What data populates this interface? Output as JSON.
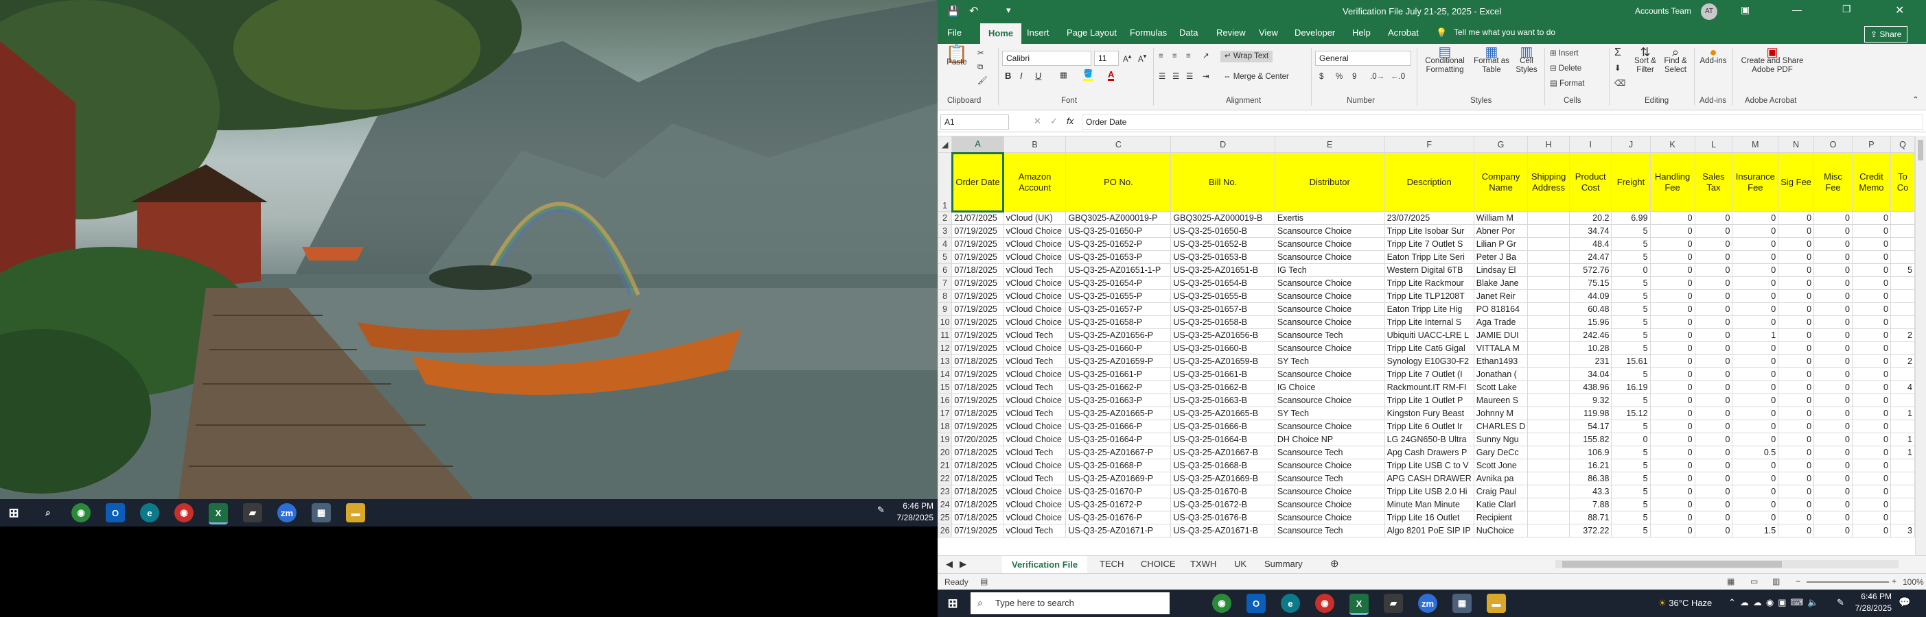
{
  "left_taskbar": {
    "time": "6:46 PM",
    "date": "7/28/2025"
  },
  "excel": {
    "quick_access": {
      "autosave_glyph": "💾",
      "undo_glyph": "↶"
    },
    "title": "Verification File July 21-25, 2025  -  Excel",
    "account": "Accounts Team",
    "account_initials": "AT",
    "tabs": [
      "File",
      "Home",
      "Insert",
      "Page Layout",
      "Formulas",
      "Data",
      "Review",
      "View",
      "Developer",
      "Help",
      "Acrobat"
    ],
    "tell_me": "Tell me what you want to do",
    "share": "Share",
    "ribbon": {
      "clipboard": {
        "label": "Clipboard",
        "paste": "Paste"
      },
      "font": {
        "label": "Font",
        "name": "Calibri",
        "size": "11",
        "bold": "B",
        "italic": "I",
        "underline": "U"
      },
      "alignment": {
        "label": "Alignment",
        "wrap": "Wrap Text",
        "merge": "Merge & Center"
      },
      "number": {
        "label": "Number",
        "format": "General",
        "currency": "$",
        "percent": "%",
        "comma": "9"
      },
      "styles": {
        "label": "Styles",
        "conditional": "Conditional Formatting",
        "format_table": "Format as Table",
        "cell_styles": "Cell Styles"
      },
      "cells": {
        "label": "Cells",
        "insert": "Insert",
        "delete": "Delete",
        "format": "Format"
      },
      "editing": {
        "label": "Editing",
        "sort": "Sort & Filter",
        "find": "Find & Select"
      },
      "addins": {
        "label": "Add-ins",
        "btn": "Add-ins"
      },
      "acrobat": {
        "label": "Adobe Acrobat",
        "btn": "Create and Share Adobe PDF"
      }
    },
    "name_box": "A1",
    "formula_glyphs": {
      "cancel": "✕",
      "enter": "✓",
      "fx": "fx"
    },
    "formula_value": "Order Date",
    "columns": [
      "A",
      "B",
      "C",
      "D",
      "E",
      "F",
      "G",
      "H",
      "I",
      "J",
      "K",
      "L",
      "M",
      "N",
      "O",
      "P",
      "Q"
    ],
    "header_row": [
      "Order Date",
      "Amazon Account",
      "PO No.",
      "Bill No.",
      "Distributor",
      "Description",
      "Company Name",
      "Shipping Address",
      "Product Cost",
      "Freight",
      "Handling Fee",
      "Sales Tax",
      "Insurance Fee",
      "Sig Fee",
      "Misc Fee",
      "Credit Memo",
      "To Co"
    ],
    "rows": [
      {
        "n": "2",
        "c": [
          "21/07/2025",
          "vCloud (UK)",
          "GBQ3025-AZ000019-P",
          "GBQ3025-AZ000019-B",
          "Exertis",
          "23/07/2025",
          "William M",
          "",
          "20.2",
          "6.99",
          "0",
          "0",
          "0",
          "0",
          "0",
          "0",
          ""
        ]
      },
      {
        "n": "3",
        "c": [
          "07/19/2025",
          "vCloud Choice",
          "US-Q3-25-01650-P",
          "US-Q3-25-01650-B",
          "Scansource Choice",
          "Tripp Lite Isobar Sur",
          "Abner Por",
          "",
          "34.74",
          "5",
          "0",
          "0",
          "0",
          "0",
          "0",
          "0",
          ""
        ]
      },
      {
        "n": "4",
        "c": [
          "07/19/2025",
          "vCloud Choice",
          "US-Q3-25-01652-P",
          "US-Q3-25-01652-B",
          "Scansource Choice",
          "Tripp Lite 7 Outlet S",
          "Lilian P Gr",
          "",
          "48.4",
          "5",
          "0",
          "0",
          "0",
          "0",
          "0",
          "0",
          ""
        ]
      },
      {
        "n": "5",
        "c": [
          "07/19/2025",
          "vCloud Choice",
          "US-Q3-25-01653-P",
          "US-Q3-25-01653-B",
          "Scansource Choice",
          "Eaton Tripp Lite Seri",
          "Peter J Ba",
          "",
          "24.47",
          "5",
          "0",
          "0",
          "0",
          "0",
          "0",
          "0",
          ""
        ]
      },
      {
        "n": "6",
        "c": [
          "07/18/2025",
          "vCloud Tech",
          "US-Q3-25-AZ01651-1-P",
          "US-Q3-25-AZ01651-B",
          "IG Tech",
          "Western Digital 6TB",
          "Lindsay El",
          "",
          "572.76",
          "0",
          "0",
          "0",
          "0",
          "0",
          "0",
          "0",
          "5"
        ]
      },
      {
        "n": "7",
        "c": [
          "07/19/2025",
          "vCloud Choice",
          "US-Q3-25-01654-P",
          "US-Q3-25-01654-B",
          "Scansource Choice",
          "Tripp Lite Rackmour",
          "Blake Jane",
          "",
          "75.15",
          "5",
          "0",
          "0",
          "0",
          "0",
          "0",
          "0",
          ""
        ]
      },
      {
        "n": "8",
        "c": [
          "07/19/2025",
          "vCloud Choice",
          "US-Q3-25-01655-P",
          "US-Q3-25-01655-B",
          "Scansource Choice",
          "Tripp Lite TLP1208T",
          "Janet Reir",
          "",
          "44.09",
          "5",
          "0",
          "0",
          "0",
          "0",
          "0",
          "0",
          ""
        ]
      },
      {
        "n": "9",
        "c": [
          "07/19/2025",
          "vCloud Choice",
          "US-Q3-25-01657-P",
          "US-Q3-25-01657-B",
          "Scansource Choice",
          "Eaton Tripp Lite Hig",
          "PO 818164",
          "",
          "60.48",
          "5",
          "0",
          "0",
          "0",
          "0",
          "0",
          "0",
          ""
        ]
      },
      {
        "n": "10",
        "c": [
          "07/19/2025",
          "vCloud Choice",
          "US-Q3-25-01658-P",
          "US-Q3-25-01658-B",
          "Scansource Choice",
          "Tripp Lite Internal S",
          "Aga Trade",
          "",
          "15.96",
          "5",
          "0",
          "0",
          "0",
          "0",
          "0",
          "0",
          ""
        ]
      },
      {
        "n": "11",
        "c": [
          "07/19/2025",
          "vCloud Tech",
          "US-Q3-25-AZ01656-P",
          "US-Q3-25-AZ01656-B",
          "Scansource Tech",
          "Ubiquiti UACC-LRE L",
          "JAMIE DUI",
          "",
          "242.46",
          "5",
          "0",
          "0",
          "1",
          "0",
          "0",
          "0",
          "2"
        ]
      },
      {
        "n": "12",
        "c": [
          "07/19/2025",
          "vCloud Choice",
          "US-Q3-25-01660-P",
          "US-Q3-25-01660-B",
          "Scansource Choice",
          "Tripp Lite Cat6 Gigal",
          "VITTALA M",
          "",
          "10.28",
          "5",
          "0",
          "0",
          "0",
          "0",
          "0",
          "0",
          ""
        ]
      },
      {
        "n": "13",
        "c": [
          "07/18/2025",
          "vCloud Tech",
          "US-Q3-25-AZ01659-P",
          "US-Q3-25-AZ01659-B",
          "SY Tech",
          "Synology E10G30-F2",
          "Ethan1493",
          "",
          "231",
          "15.61",
          "0",
          "0",
          "0",
          "0",
          "0",
          "0",
          "2"
        ]
      },
      {
        "n": "14",
        "c": [
          "07/19/2025",
          "vCloud Choice",
          "US-Q3-25-01661-P",
          "US-Q3-25-01661-B",
          "Scansource Choice",
          "Tripp Lite 7 Outlet (I",
          "Jonathan (",
          "",
          "34.04",
          "5",
          "0",
          "0",
          "0",
          "0",
          "0",
          "0",
          ""
        ]
      },
      {
        "n": "15",
        "c": [
          "07/18/2025",
          "vCloud Tech",
          "US-Q3-25-01662-P",
          "US-Q3-25-01662-B",
          "IG Choice",
          "Rackmount.IT RM-FI",
          "Scott Lake",
          "",
          "438.96",
          "16.19",
          "0",
          "0",
          "0",
          "0",
          "0",
          "0",
          "4"
        ]
      },
      {
        "n": "16",
        "c": [
          "07/19/2025",
          "vCloud Choice",
          "US-Q3-25-01663-P",
          "US-Q3-25-01663-B",
          "Scansource Choice",
          "Tripp Lite 1 Outlet P",
          "Maureen S",
          "",
          "9.32",
          "5",
          "0",
          "0",
          "0",
          "0",
          "0",
          "0",
          ""
        ]
      },
      {
        "n": "17",
        "c": [
          "07/18/2025",
          "vCloud Tech",
          "US-Q3-25-AZ01665-P",
          "US-Q3-25-AZ01665-B",
          "SY Tech",
          "Kingston Fury Beast",
          "Johnny M",
          "",
          "119.98",
          "15.12",
          "0",
          "0",
          "0",
          "0",
          "0",
          "0",
          "1"
        ]
      },
      {
        "n": "18",
        "c": [
          "07/19/2025",
          "vCloud Choice",
          "US-Q3-25-01666-P",
          "US-Q3-25-01666-B",
          "Scansource Choice",
          "Tripp Lite 6 Outlet Ir",
          "CHARLES D",
          "",
          "54.17",
          "5",
          "0",
          "0",
          "0",
          "0",
          "0",
          "0",
          ""
        ]
      },
      {
        "n": "19",
        "c": [
          "07/20/2025",
          "vCloud Choice",
          "US-Q3-25-01664-P",
          "US-Q3-25-01664-B",
          "DH Choice NP",
          "LG 24GN650-B Ultra",
          "Sunny Ngu",
          "",
          "155.82",
          "0",
          "0",
          "0",
          "0",
          "0",
          "0",
          "0",
          "1"
        ]
      },
      {
        "n": "20",
        "c": [
          "07/18/2025",
          "vCloud Tech",
          "US-Q3-25-AZ01667-P",
          "US-Q3-25-AZ01667-B",
          "Scansource Tech",
          "Apg Cash Drawers P",
          "Gary DeCc",
          "",
          "106.9",
          "5",
          "0",
          "0",
          "0.5",
          "0",
          "0",
          "0",
          "1"
        ]
      },
      {
        "n": "21",
        "c": [
          "07/18/2025",
          "vCloud Choice",
          "US-Q3-25-01668-P",
          "US-Q3-25-01668-B",
          "Scansource Choice",
          "Tripp Lite USB C to V",
          "Scott Jone",
          "",
          "16.21",
          "5",
          "0",
          "0",
          "0",
          "0",
          "0",
          "0",
          ""
        ]
      },
      {
        "n": "22",
        "c": [
          "07/18/2025",
          "vCloud Tech",
          "US-Q3-25-AZ01669-P",
          "US-Q3-25-AZ01669-B",
          "Scansource Tech",
          "APG CASH DRAWER",
          "Avnika pa",
          "",
          "86.38",
          "5",
          "0",
          "0",
          "0",
          "0",
          "0",
          "0",
          ""
        ]
      },
      {
        "n": "23",
        "c": [
          "07/18/2025",
          "vCloud Choice",
          "US-Q3-25-01670-P",
          "US-Q3-25-01670-B",
          "Scansource Choice",
          "Tripp Lite USB 2.0 Hi",
          "Craig Paul",
          "",
          "43.3",
          "5",
          "0",
          "0",
          "0",
          "0",
          "0",
          "0",
          ""
        ]
      },
      {
        "n": "24",
        "c": [
          "07/18/2025",
          "vCloud Choice",
          "US-Q3-25-01672-P",
          "US-Q3-25-01672-B",
          "Scansource Choice",
          "Minute Man Minute",
          "Katie Clarl",
          "",
          "7.88",
          "5",
          "0",
          "0",
          "0",
          "0",
          "0",
          "0",
          ""
        ]
      },
      {
        "n": "25",
        "c": [
          "07/18/2025",
          "vCloud Choice",
          "US-Q3-25-01676-P",
          "US-Q3-25-01676-B",
          "Scansource Choice",
          "Tripp Lite 16 Outlet",
          "Recipient",
          "",
          "88.71",
          "5",
          "0",
          "0",
          "0",
          "0",
          "0",
          "0",
          ""
        ]
      },
      {
        "n": "26",
        "c": [
          "07/19/2025",
          "vCloud Tech",
          "US-Q3-25-AZ01671-P",
          "US-Q3-25-AZ01671-B",
          "Scansource Tech",
          "Algo 8201 PoE SIP IP",
          "NuChoice",
          "",
          "372.22",
          "5",
          "0",
          "0",
          "1.5",
          "0",
          "0",
          "0",
          "3"
        ]
      }
    ],
    "sheet_tabs": [
      "Verification File",
      "TECH",
      "CHOICE",
      "TXWH",
      "UK",
      "Summary"
    ],
    "status": "Ready",
    "zoom": "100%"
  },
  "right_taskbar": {
    "search_placeholder": "Type here to search",
    "weather": "36°C  Haze",
    "time": "6:46 PM",
    "date": "7/28/2025"
  },
  "colors": {
    "excel_green": "#217346",
    "header_yellow": "#ffff00",
    "taskbar": "#1b2230"
  }
}
